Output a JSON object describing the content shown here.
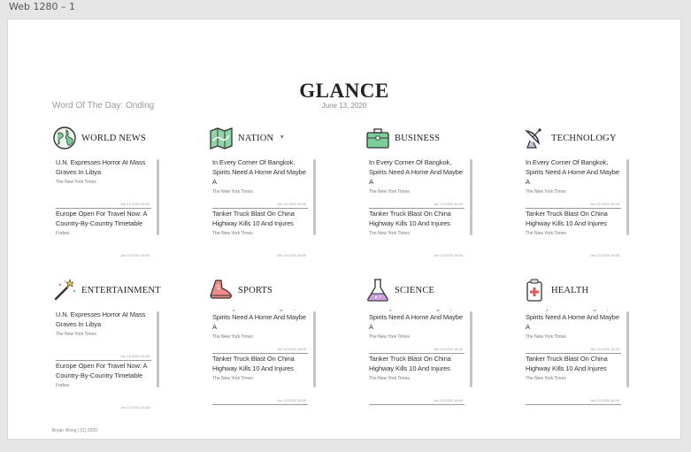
{
  "artboard_label": "Web 1280 – 1",
  "title": "GLANCE",
  "date": "June 13, 2020",
  "word_of_day": "Word Of The Day: Onding",
  "footer": "Bryan Wong | (C) 2020",
  "sections": [
    {
      "title": "WORLD NEWS",
      "icon": "globe-icon",
      "articles": [
        {
          "headline": "U.N. Expresses Horror At Mass Graves In Libya",
          "source": "The New York Times",
          "time": "Jun 13 2020 16:45"
        },
        {
          "headline": "Europe Open For Travel Now: A Country-By-Country Timetable",
          "source": "Forbes",
          "time": "Jun 13 2020 16:45"
        }
      ]
    },
    {
      "title": "NATION",
      "caret": "▼",
      "icon": "map-icon",
      "articles": [
        {
          "headline": "In Every Corner Of Bangkok, Spirits Need A Home And Maybe A",
          "source": "The New York Times",
          "time": "Jun 13 2020 16:45"
        },
        {
          "headline": "Tanker Truck Blast On China Highway Kills 10 And Injures",
          "source": "The New York Times",
          "time": "Jun 13 2020 16:45"
        }
      ]
    },
    {
      "title": "BUSINESS",
      "icon": "briefcase-icon",
      "articles": [
        {
          "headline": "In Every Corner Of Bangkok, Spirits Need A Home And Maybe A",
          "source": "The New York Times",
          "time": "Jun 13 2020 16:45"
        },
        {
          "headline": "Tanker Truck Blast On China Highway Kills 10 And Injures",
          "source": "The New York Times",
          "time": "Jun 13 2020 16:45"
        }
      ]
    },
    {
      "title": "TECHNOLOGY",
      "icon": "satellite-dish-icon",
      "articles": [
        {
          "headline": "In Every Corner Of Bangkok, Spirits Need A Home And Maybe A",
          "source": "The New York Times",
          "time": "Jun 13 2020 16:45"
        },
        {
          "headline": "Tanker Truck Blast On China Highway Kills 10 And Injures",
          "source": "The New York Times",
          "time": "Jun 13 2020 16:45"
        }
      ]
    },
    {
      "title": "ENTERTAINMENT",
      "icon": "magic-wand-icon",
      "articles": [
        {
          "headline": "U.N. Expresses Horror At Mass Graves In Libya",
          "source": "The New York Times",
          "time": "Jun 13 2020 16:45"
        },
        {
          "headline": "Europe Open For Travel Now: A Country-By-Country Timetable",
          "source": "Forbes",
          "time": "Jun 13 2020 16:45"
        }
      ]
    },
    {
      "title": "SPORTS",
      "icon": "sneaker-icon",
      "articles": [
        {
          "headline": "In Every Corner Of Bangkok, Spirits Need A Home And Maybe A",
          "source": "The New York Times",
          "time": "Jun 13 2020 16:45"
        },
        {
          "headline": "Tanker Truck Blast On China Highway Kills 10 And Injures",
          "source": "The New York Times",
          "time": "Jun 13 2020 16:45"
        }
      ]
    },
    {
      "title": "SCIENCE",
      "icon": "flask-icon",
      "articles": [
        {
          "headline": "In Every Corner Of Bangkok, Spirits Need A Home And Maybe A",
          "source": "The New York Times",
          "time": "Jun 13 2020 16:45"
        },
        {
          "headline": "Tanker Truck Blast On China Highway Kills 10 And Injures",
          "source": "The New York Times",
          "time": "Jun 13 2020 16:45"
        }
      ]
    },
    {
      "title": "HEALTH",
      "icon": "medical-kit-icon",
      "articles": [
        {
          "headline": "In Every Corner Of Bangkok, Spirits Need A Home And Maybe A",
          "source": "The New York Times",
          "time": "Jun 13 2020 16:45"
        },
        {
          "headline": "Tanker Truck Blast On China Highway Kills 10 And Injures",
          "source": "The New York Times",
          "time": "Jun 13 2020 16:45"
        }
      ]
    }
  ]
}
